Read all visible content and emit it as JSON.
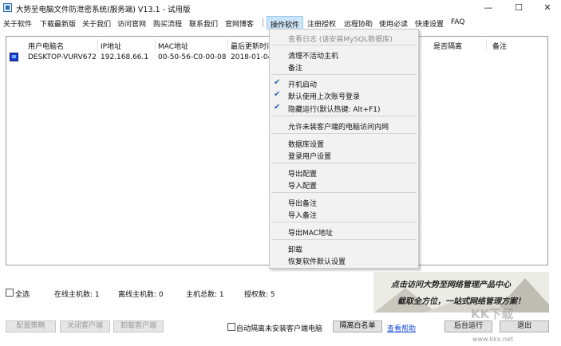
{
  "window": {
    "title": "大势至电脑文件防泄密系统(服务端) V13.1 - 试用版",
    "minimize": "—",
    "maximize": "☐",
    "close": "✕"
  },
  "menu": {
    "items": [
      "关于软件",
      "下载最新版",
      "关于我们",
      "访问官网",
      "购买流程",
      "联系我们",
      "官网博客",
      "操作软件",
      "注册授权",
      "远程协助",
      "使用必读",
      "快速设置",
      "FAQ"
    ]
  },
  "table": {
    "columns": [
      "用户电脑名",
      "IP地址",
      "MAC地址",
      "最后更新时间",
      "是否隔离",
      "备注"
    ],
    "rows": [
      {
        "name": "DESKTOP-VURV672",
        "ip": "192.168.66.1",
        "mac": "00-50-56-C0-00-08",
        "time": "2018-01-04"
      }
    ]
  },
  "dropdown": {
    "items": [
      {
        "label": "查看日志 (请安装MySQL数据库)",
        "disabled": true
      },
      {
        "label": "清理不活动主机"
      },
      {
        "label": "备注"
      },
      {
        "label": "开机启动",
        "checked": true
      },
      {
        "label": "默认使用上次账号登录",
        "checked": true
      },
      {
        "label": "隐藏运行(默认热键: Alt+F1)",
        "checked": true
      },
      {
        "label": "允许未装客户端的电脑访问内网"
      },
      {
        "label": "数据库设置"
      },
      {
        "label": "登录用户设置"
      },
      {
        "label": "导出配置"
      },
      {
        "label": "导入配置"
      },
      {
        "label": "导出备注"
      },
      {
        "label": "导入备注"
      },
      {
        "label": "导出MAC地址"
      },
      {
        "label": "卸载"
      },
      {
        "label": "恢复软件默认设置"
      }
    ]
  },
  "status": {
    "select_all": "全选",
    "online": "在线主机数: 1",
    "offline": "离线主机数: 0",
    "total": "主机总数: 1",
    "license": "授权数: 5"
  },
  "banner": {
    "line1": "点击访问大势至网络管理产品中心",
    "line2": "截取全方位，一站式网络管理方案！"
  },
  "buttons": {
    "config_policy": "配置策略",
    "close_client": "关闭客户端",
    "uninstall_client": "卸载客户端",
    "auto_isolate": "自动隔离未安装客户端电脑",
    "isolate_whitelist": "隔离白名单",
    "help": "查看帮助",
    "background_run": "后台运行",
    "exit": "退出"
  },
  "watermark": {
    "logo": "KK下载",
    "url": "www.kkx.net"
  }
}
